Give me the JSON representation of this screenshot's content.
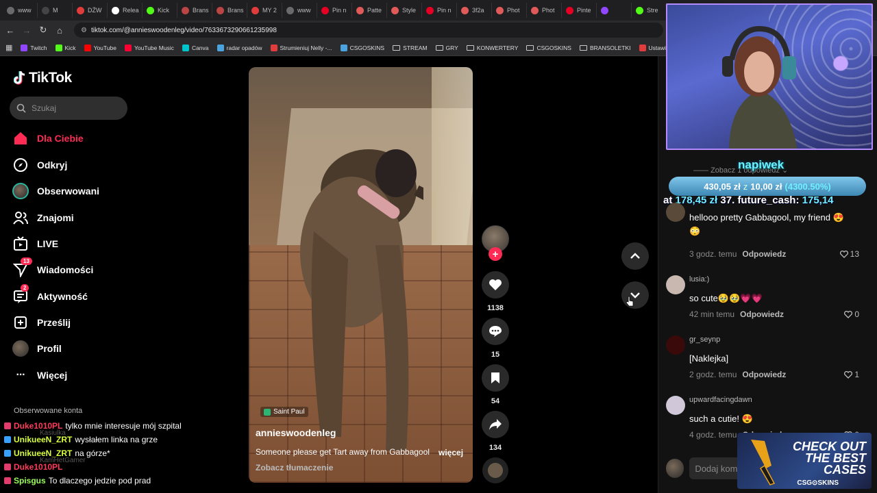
{
  "browser": {
    "tabs": [
      {
        "label": "www",
        "color": "#6a6a6a"
      },
      {
        "label": "M",
        "color": "#444"
      },
      {
        "label": "DŹW",
        "color": "#e03c3c"
      },
      {
        "label": "Relea",
        "color": "#ffffff"
      },
      {
        "label": "Kick",
        "color": "#53fc18"
      },
      {
        "label": "Brans",
        "color": "#b44"
      },
      {
        "label": "Brans",
        "color": "#b44"
      },
      {
        "label": "MY 2",
        "color": "#e03c3c"
      },
      {
        "label": "www",
        "color": "#6a6a6a"
      },
      {
        "label": "Pin n",
        "color": "#e60023"
      },
      {
        "label": "Patte",
        "color": "#e05a5a"
      },
      {
        "label": "Style",
        "color": "#e05a5a"
      },
      {
        "label": "Pin n",
        "color": "#e60023"
      },
      {
        "label": "3f2a",
        "color": "#e05a5a"
      },
      {
        "label": "Phot",
        "color": "#e05a5a"
      },
      {
        "label": "Phot",
        "color": "#e05a5a"
      },
      {
        "label": "Pinte",
        "color": "#e60023"
      },
      {
        "label": "",
        "color": "#9146ff"
      },
      {
        "label": "Stre",
        "color": "#53fc18"
      }
    ],
    "url": "tiktok.com/@annieswoodenleg/video/7633673290661235998",
    "bookmarks": [
      {
        "label": "Twitch",
        "color": "#9146ff",
        "type": "icon"
      },
      {
        "label": "Kick",
        "color": "#53fc18",
        "type": "icon"
      },
      {
        "label": "YouTube",
        "color": "#ff0000",
        "type": "icon"
      },
      {
        "label": "YouTube Music",
        "color": "#ff0033",
        "type": "icon"
      },
      {
        "label": "Canva",
        "color": "#00c4cc",
        "type": "icon"
      },
      {
        "label": "radar opadów",
        "color": "#4aa3df",
        "type": "icon"
      },
      {
        "label": "Strumieniuj Nelly -...",
        "color": "#e03c3c",
        "type": "icon"
      },
      {
        "label": "CSGOSKINS",
        "color": "#4aa3df",
        "type": "icon"
      },
      {
        "label": "STREAM",
        "color": "",
        "type": "folder"
      },
      {
        "label": "GRY",
        "color": "",
        "type": "folder"
      },
      {
        "label": "KONWERTERY",
        "color": "",
        "type": "folder"
      },
      {
        "label": "CSGOSKINS",
        "color": "",
        "type": "folder"
      },
      {
        "label": "BRANSOLETKI",
        "color": "",
        "type": "folder"
      },
      {
        "label": "Ustawienia strumien...",
        "color": "#e03c3c",
        "type": "icon"
      }
    ]
  },
  "tiktok": {
    "logo": "TikTok",
    "search_placeholder": "Szukaj",
    "nav": [
      {
        "label": "Dla Ciebie",
        "icon": "home-icon",
        "active": true,
        "badge": ""
      },
      {
        "label": "Odkryj",
        "icon": "compass-icon",
        "active": false,
        "badge": ""
      },
      {
        "label": "Obserwowani",
        "icon": "avatar-icon",
        "active": false,
        "badge": ""
      },
      {
        "label": "Znajomi",
        "icon": "friends-icon",
        "active": false,
        "badge": ""
      },
      {
        "label": "LIVE",
        "icon": "live-tv-icon",
        "active": false,
        "badge": ""
      },
      {
        "label": "Wiadomości",
        "icon": "messages-icon",
        "active": false,
        "badge": "13"
      },
      {
        "label": "Aktywność",
        "icon": "activity-icon",
        "active": false,
        "badge": "2"
      },
      {
        "label": "Prześlij",
        "icon": "upload-icon",
        "active": false,
        "badge": ""
      },
      {
        "label": "Profil",
        "icon": "profile-avatar-icon",
        "active": false,
        "badge": ""
      },
      {
        "label": "Więcej",
        "icon": "more-dots-icon",
        "active": false,
        "badge": ""
      }
    ],
    "followed_accounts_title": "Obserwowane konta",
    "video": {
      "location": "Saint Paul",
      "author": "annieswoodenleg",
      "caption": "Someone please get Tart away from Gabbagool",
      "more_label": "więcej",
      "translate_label": "Zobacz tłumaczenie"
    },
    "actions": {
      "likes": "1138",
      "comments": "15",
      "saves": "54",
      "shares": "134"
    },
    "comments_panel": {
      "replies_label": "Zobacz 1 odpowiedź",
      "comments": [
        {
          "user": "",
          "text": "hellooo pretty Gabbagool, my friend 😍😳",
          "time": "3 godz. temu",
          "reply": "Odpowiedz",
          "likes": "13"
        },
        {
          "user": "lusia:)",
          "text": "so cute🥹🥹💗💗",
          "time": "42 min temu",
          "reply": "Odpowiedz",
          "likes": "0"
        },
        {
          "user": "gr_seynp",
          "text": "[Naklejka]",
          "time": "2 godz. temu",
          "reply": "Odpowiedz",
          "likes": "1"
        },
        {
          "user": "upwardfacingdawn",
          "text": "such a cutie! 😍",
          "time": "4 godz. temu",
          "reply": "Odpowiedz",
          "likes": "0"
        }
      ],
      "add_comment_placeholder": "Dodaj kom"
    }
  },
  "stream_overlay": {
    "tip_label": "napiwek",
    "stat_main": "430,05 zł",
    "stat_z": "z",
    "stat_base": "10,00 zł",
    "stat_pct": "(4300.50%)",
    "ticker_prefix": "at",
    "ticker_a": "178,45 zł",
    "ticker_b": "37.",
    "ticker_name": "future_cash:",
    "ticker_c": "175,14",
    "chat": [
      {
        "user": "Duke1010PL",
        "user_color": "#ff3b5c",
        "msg": "tylko mnie interesuje mój szpital"
      },
      {
        "user": "UnikueeN_ZRT",
        "user_color": "#d9ff3b",
        "msg": "wysłałem linka na grze"
      },
      {
        "user": "UnikueeN_ZRT",
        "user_color": "#d9ff3b",
        "msg": "na górze*"
      },
      {
        "user": "Duke1010PL",
        "user_color": "#ff3b5c",
        "msg": ""
      },
      {
        "user": "Spisgus",
        "user_color": "#9bff5b",
        "msg": "To dlaczego jedzie pod prad"
      }
    ],
    "ad": {
      "line1": "CHECK OUT",
      "line2": "THE BEST",
      "line3": "CASES",
      "brand": "CSG⊙SKINS"
    }
  },
  "colors": {
    "accent": "#fe2c55",
    "tiktok_bg": "#000000",
    "tip_cyan": "#6ff0ff"
  }
}
